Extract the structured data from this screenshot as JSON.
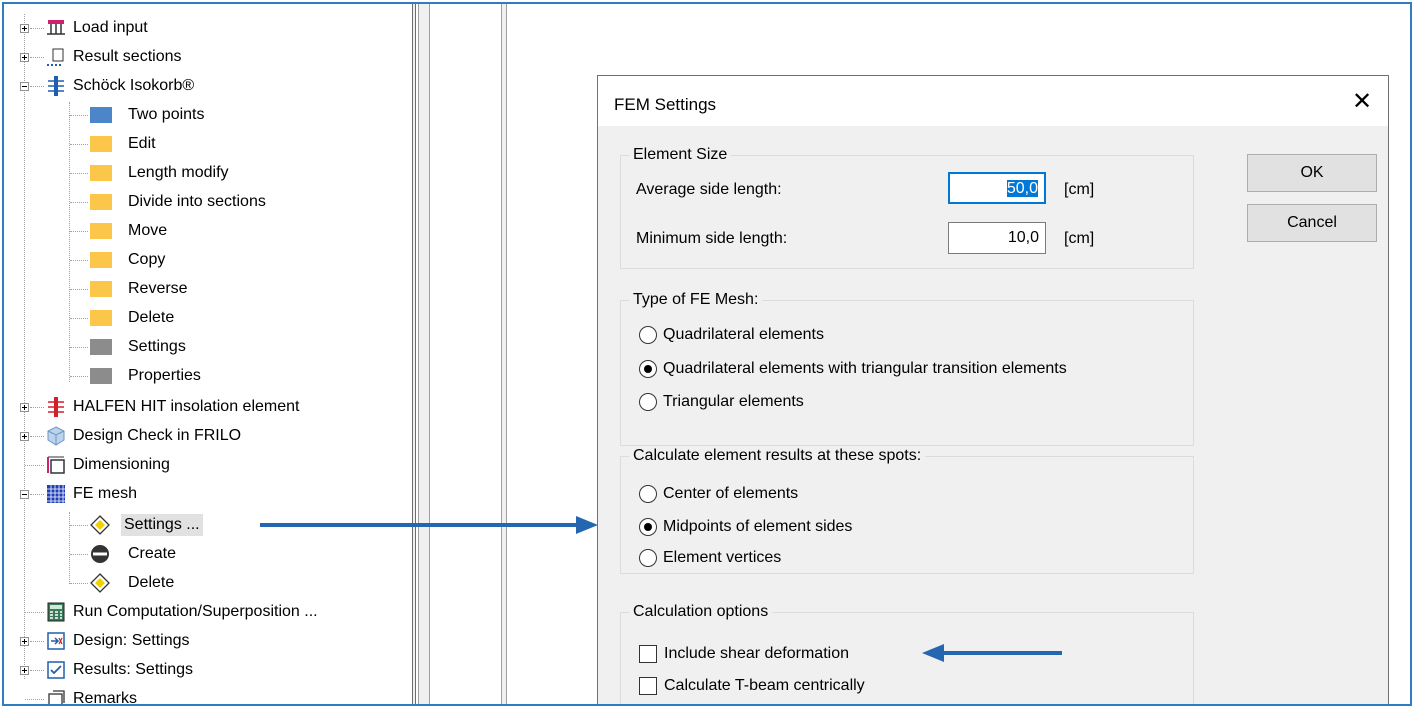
{
  "tree": {
    "items": [
      {
        "label": "Load input",
        "icon": "load-input-icon"
      },
      {
        "label": "Result sections",
        "icon": "result-sections-icon"
      },
      {
        "label": "Schöck Isokorb®",
        "icon": "isokorb-icon"
      },
      {
        "label": "Two points",
        "icon": "blue-square-icon"
      },
      {
        "label": "Edit",
        "icon": "yellow-square-icon"
      },
      {
        "label": "Length modify",
        "icon": "yellow-square-icon"
      },
      {
        "label": "Divide into sections",
        "icon": "yellow-square-icon"
      },
      {
        "label": "Move",
        "icon": "yellow-square-icon"
      },
      {
        "label": "Copy",
        "icon": "yellow-square-icon"
      },
      {
        "label": "Reverse",
        "icon": "yellow-square-icon"
      },
      {
        "label": "Delete",
        "icon": "yellow-square-icon"
      },
      {
        "label": "Settings",
        "icon": "gray-square-icon"
      },
      {
        "label": "Properties",
        "icon": "gray-square-icon"
      },
      {
        "label": "HALFEN HIT insolation element",
        "icon": "halfen-icon"
      },
      {
        "label": "Design Check in FRILO",
        "icon": "design-check-icon"
      },
      {
        "label": "Dimensioning",
        "icon": "dimensioning-icon"
      },
      {
        "label": "FE mesh",
        "icon": "fe-mesh-icon"
      },
      {
        "label": "Settings ...",
        "icon": "diamond-icon"
      },
      {
        "label": "Create",
        "icon": "minus-circle-icon"
      },
      {
        "label": "Delete",
        "icon": "diamond-icon"
      },
      {
        "label": "Run Computation/Superposition ...",
        "icon": "calculator-icon"
      },
      {
        "label": "Design: Settings",
        "icon": "design-settings-icon"
      },
      {
        "label": "Results: Settings",
        "icon": "results-settings-icon"
      },
      {
        "label": "Remarks",
        "icon": "remarks-icon"
      }
    ]
  },
  "dialog": {
    "title": "FEM Settings",
    "close": "✕",
    "ok": "OK",
    "cancel": "Cancel",
    "element_size": {
      "title": "Element Size",
      "avg_label": "Average side length:",
      "avg_value": "50,0",
      "min_label": "Minimum side length:",
      "min_value": "10,0",
      "unit": "[cm]"
    },
    "mesh_type": {
      "title": "Type of FE Mesh:",
      "options": [
        "Quadrilateral elements",
        "Quadrilateral elements with triangular transition elements",
        "Triangular elements"
      ],
      "selected": 1
    },
    "spots": {
      "title": "Calculate element results at these spots:",
      "options": [
        "Center of elements",
        "Midpoints of element sides",
        "Element vertices"
      ],
      "selected": 1
    },
    "calc_options": {
      "title": "Calculation options",
      "items": [
        "Include shear deformation",
        "Calculate T-beam centrically"
      ],
      "checked": [
        false,
        false
      ]
    }
  },
  "colors": {
    "arrow": "#2566b0",
    "frame": "#2f7dc0",
    "accent": "#0078d7"
  }
}
